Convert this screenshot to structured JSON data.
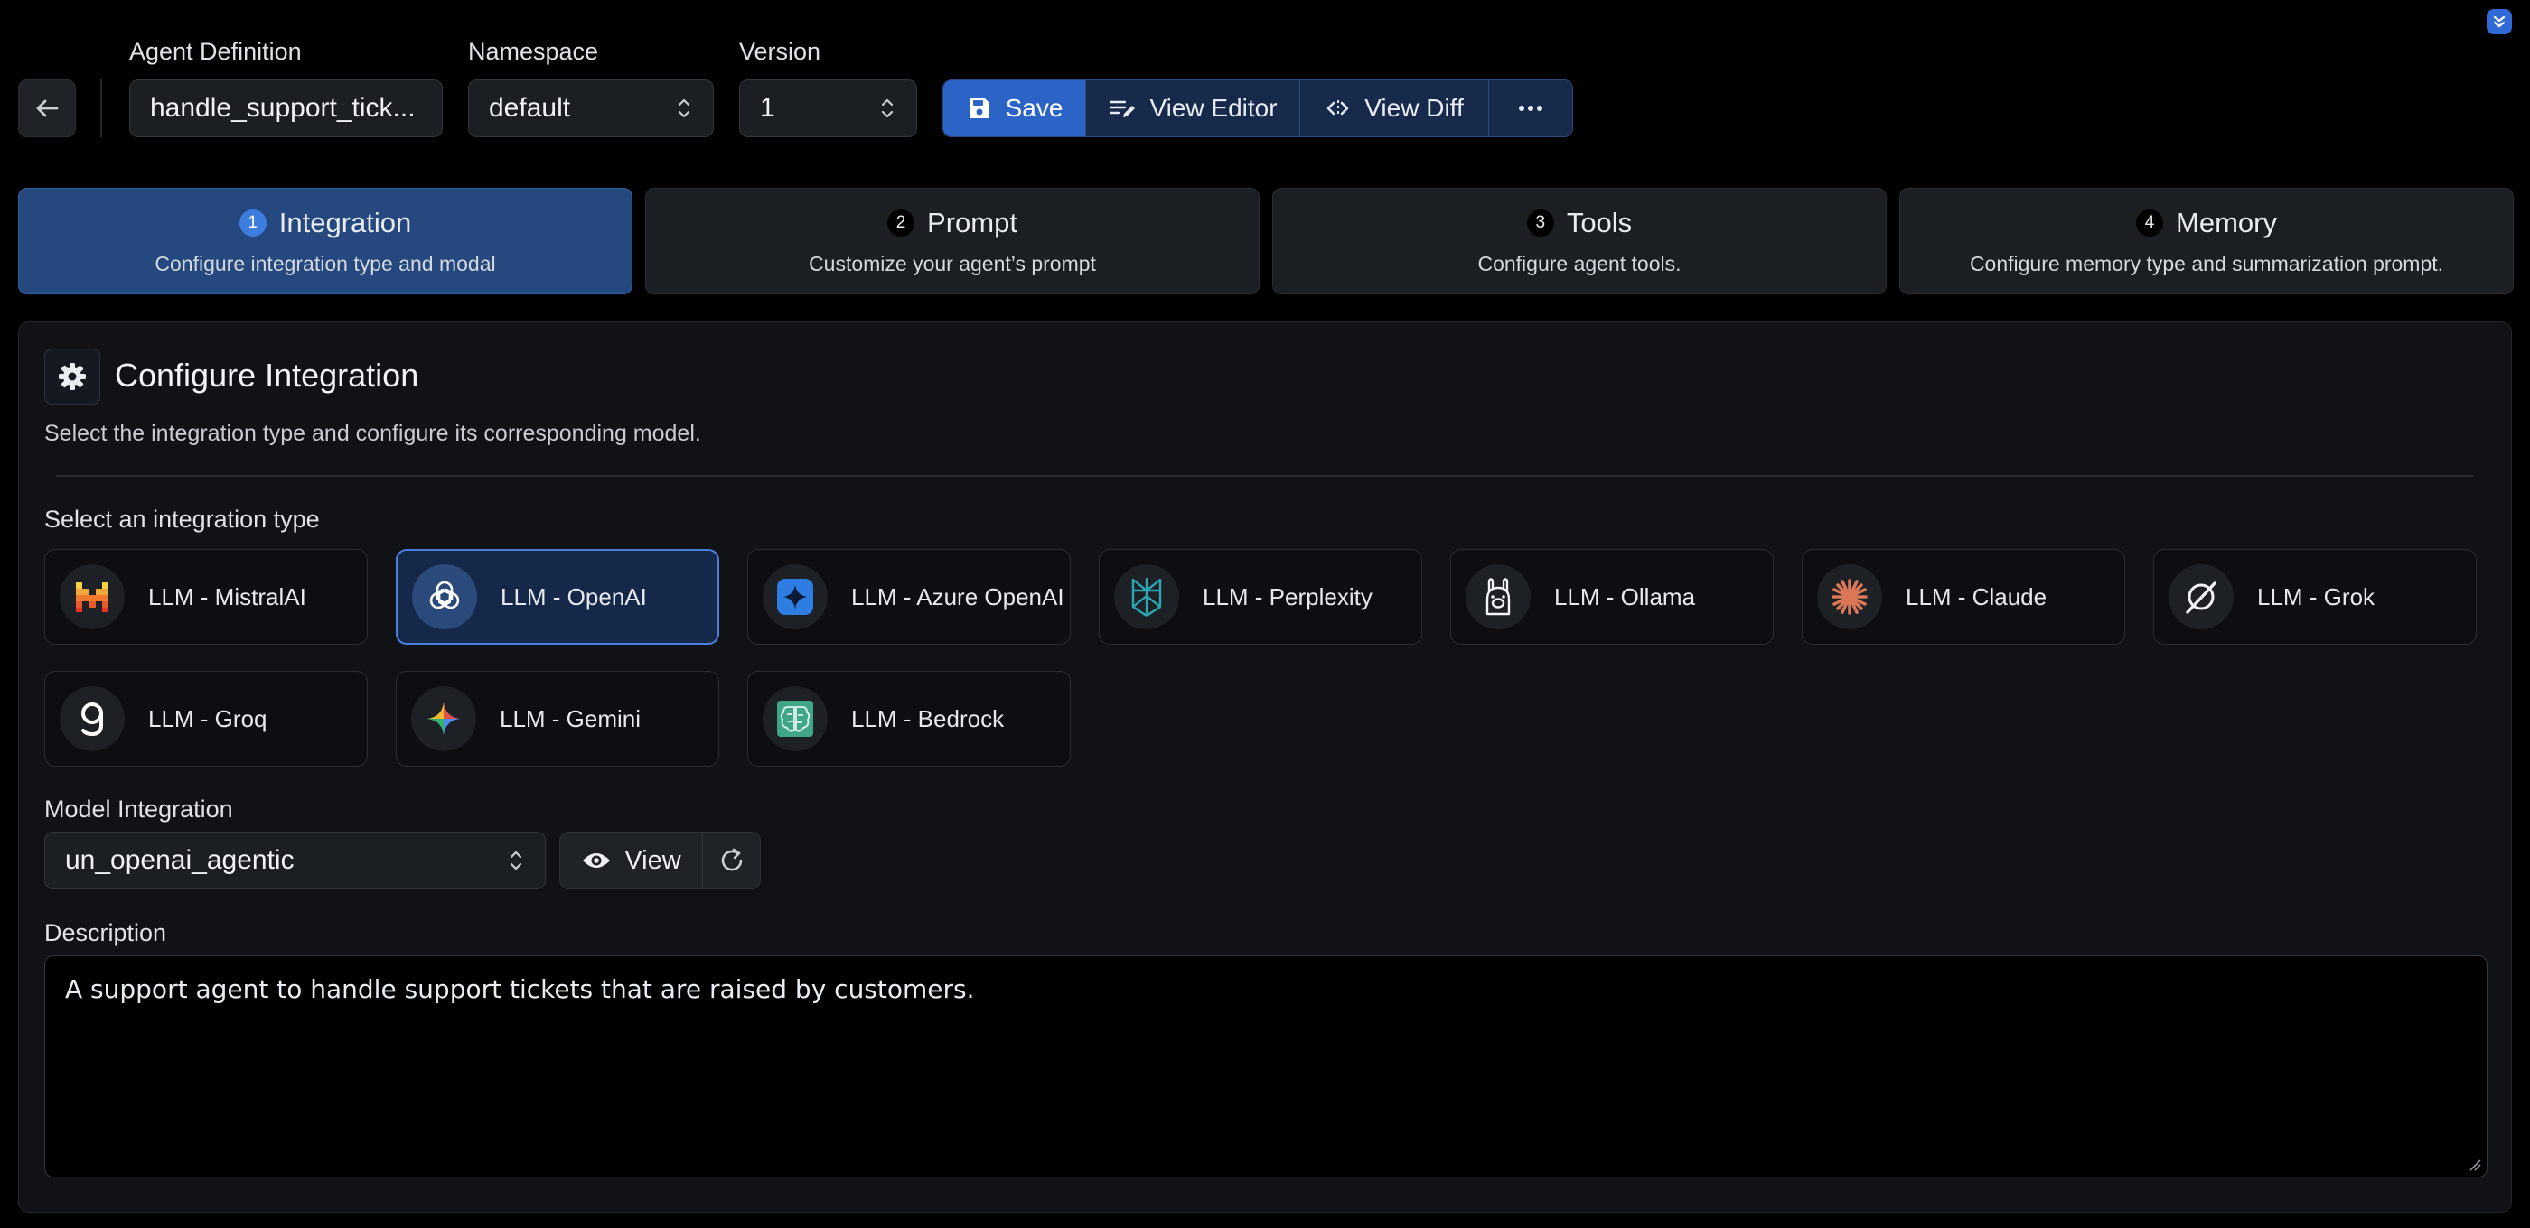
{
  "header": {
    "agent_definition": {
      "label": "Agent Definition",
      "value": "handle_support_tick..."
    },
    "namespace": {
      "label": "Namespace",
      "value": "default"
    },
    "version": {
      "label": "Version",
      "value": "1"
    },
    "actions": {
      "save": "Save",
      "view_editor": "View Editor",
      "view_diff": "View Diff",
      "more": "more-horizontal-icon"
    }
  },
  "steps": [
    {
      "num": "1",
      "title": "Integration",
      "subtitle": "Configure integration type and modal",
      "active": true
    },
    {
      "num": "2",
      "title": "Prompt",
      "subtitle": "Customize your agent’s prompt",
      "active": false
    },
    {
      "num": "3",
      "title": "Tools",
      "subtitle": "Configure agent tools.",
      "active": false
    },
    {
      "num": "4",
      "title": "Memory",
      "subtitle": "Configure memory type and summarization prompt.",
      "active": false
    }
  ],
  "panel": {
    "title": "Configure Integration",
    "subtitle": "Select the integration type and configure its corresponding model.",
    "integration_label": "Select an integration type",
    "integrations": [
      {
        "label": "LLM - MistralAI",
        "icon": "mistral-logo-icon",
        "selected": false
      },
      {
        "label": "LLM - OpenAI",
        "icon": "openai-logo-icon",
        "selected": true
      },
      {
        "label": "LLM - Azure OpenAI",
        "icon": "azure-openai-logo-icon",
        "selected": false
      },
      {
        "label": "LLM - Perplexity",
        "icon": "perplexity-logo-icon",
        "selected": false
      },
      {
        "label": "LLM - Ollama",
        "icon": "ollama-logo-icon",
        "selected": false
      },
      {
        "label": "LLM - Claude",
        "icon": "claude-logo-icon",
        "selected": false
      },
      {
        "label": "LLM - Grok",
        "icon": "grok-logo-icon",
        "selected": false
      },
      {
        "label": "LLM - Groq",
        "icon": "groq-logo-icon",
        "selected": false
      },
      {
        "label": "LLM - Gemini",
        "icon": "gemini-logo-icon",
        "selected": false
      },
      {
        "label": "LLM - Bedrock",
        "icon": "bedrock-logo-icon",
        "selected": false
      }
    ],
    "model_integration": {
      "label": "Model Integration",
      "value": "un_openai_agentic",
      "view": "View"
    },
    "description": {
      "label": "Description",
      "value": "A support agent to handle support tickets that are raised by customers."
    }
  },
  "colors": {
    "accent": "#2b63c6",
    "active_step": "#25497f",
    "background": "#000000"
  }
}
